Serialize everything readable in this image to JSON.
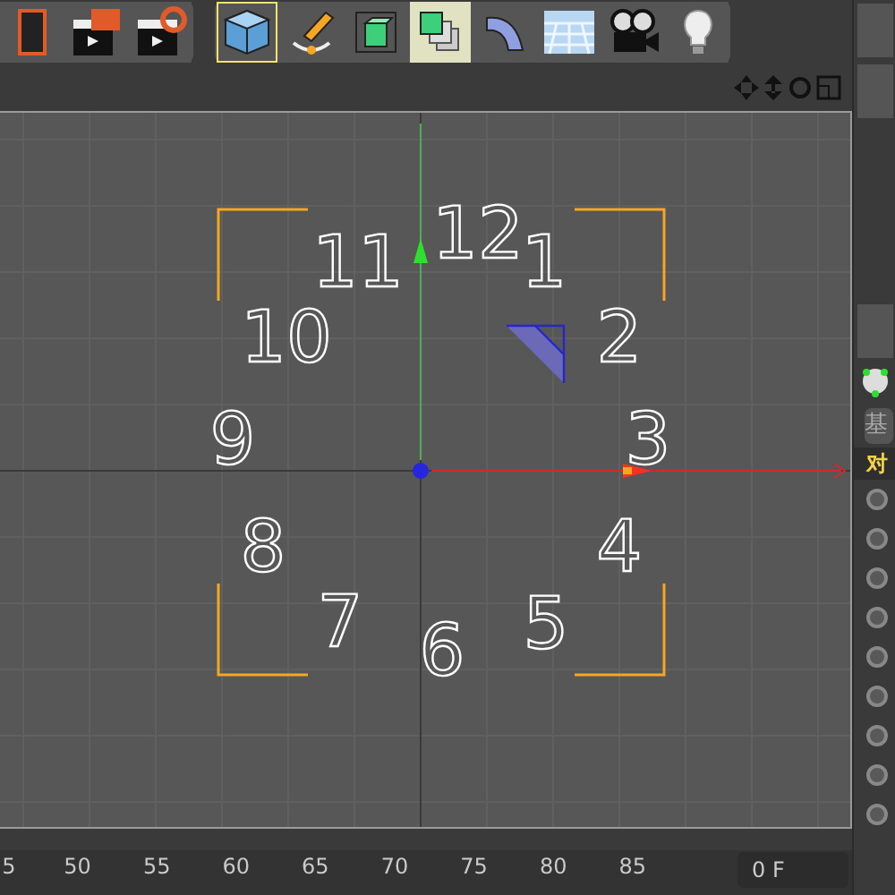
{
  "toolbar": {
    "tools": [
      {
        "kind": "render-frame",
        "selected": false
      },
      {
        "kind": "clapper",
        "selected": false
      },
      {
        "kind": "clapper-gear",
        "selected": false
      },
      {
        "kind": "cube",
        "selected": true
      },
      {
        "kind": "pen",
        "selected": false
      },
      {
        "kind": "deform-cube",
        "selected": false
      },
      {
        "kind": "cube-array",
        "selected": true
      },
      {
        "kind": "bend",
        "selected": false
      },
      {
        "kind": "floor",
        "selected": false
      },
      {
        "kind": "camera",
        "selected": false
      },
      {
        "kind": "bulb",
        "selected": false
      }
    ]
  },
  "viewport": {
    "numerals": [
      {
        "text": "12"
      },
      {
        "text": "11"
      },
      {
        "text": "1"
      },
      {
        "text": "10"
      },
      {
        "text": "2"
      },
      {
        "text": "9"
      },
      {
        "text": "3"
      },
      {
        "text": "8"
      },
      {
        "text": "4"
      },
      {
        "text": "7"
      },
      {
        "text": "5"
      },
      {
        "text": "6"
      }
    ]
  },
  "attributes": {
    "tab_label": "基",
    "header": "对",
    "radios": [
      {
        "checked": false
      },
      {
        "checked": false
      },
      {
        "checked": false
      },
      {
        "checked": false
      },
      {
        "checked": false
      },
      {
        "checked": false
      },
      {
        "checked": false
      },
      {
        "checked": false
      },
      {
        "checked": false
      }
    ]
  },
  "timeline": {
    "ticks": [
      "5",
      "50",
      "55",
      "60",
      "65",
      "70",
      "75",
      "80",
      "85"
    ],
    "frame_field": "0 F"
  }
}
